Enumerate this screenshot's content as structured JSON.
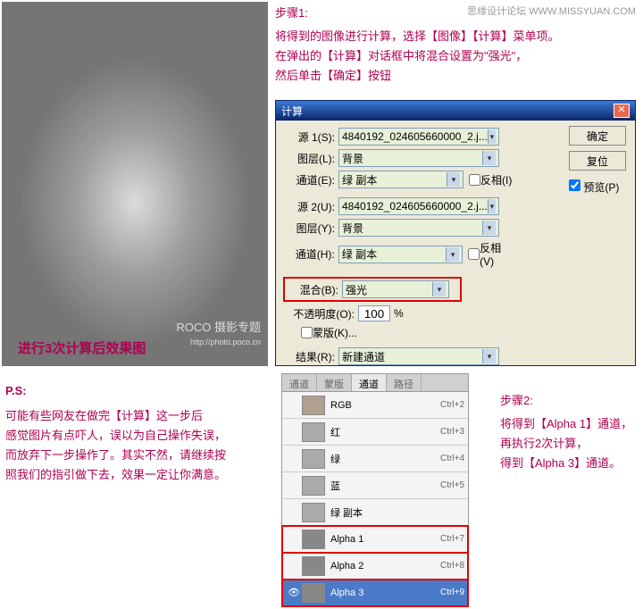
{
  "watermark": "思缘设计论坛  WWW.MISSYUAN.COM",
  "photo": {
    "caption": "进行3次计算后效果图",
    "wm": "ROCO 摄影专题",
    "wm2": "http://photo.poco.cn"
  },
  "step1": {
    "title": "步骤1:",
    "line1": "将得到的图像进行计算，选择【图像】【计算】菜单项。",
    "line2": "在弹出的【计算】对话框中将混合设置为\"强光\"，",
    "line3": "然后单击【确定】按钮"
  },
  "dialog": {
    "title": "计算",
    "source1": {
      "label": "源 1(S):",
      "value": "4840192_024605660000_2.j..."
    },
    "layer1": {
      "label": "图层(L):",
      "value": "背景"
    },
    "channel1": {
      "label": "通道(E):",
      "value": "绿 副本",
      "invert": "反相(I)"
    },
    "source2": {
      "label": "源 2(U):",
      "value": "4840192_024605660000_2.j..."
    },
    "layer2": {
      "label": "图层(Y):",
      "value": "背景"
    },
    "channel2": {
      "label": "通道(H):",
      "value": "绿 副本",
      "invert": "反相(V)"
    },
    "blend": {
      "label": "混合(B):",
      "value": "强光"
    },
    "opacity": {
      "label": "不透明度(O):",
      "value": "100",
      "pct": "%"
    },
    "mask": {
      "label": "蒙版(K)..."
    },
    "result": {
      "label": "结果(R):",
      "value": "新建通道"
    },
    "ok": "确定",
    "cancel": "复位",
    "preview": "预览(P)"
  },
  "channels": {
    "tabs": [
      "通道",
      "蒙版",
      "通道",
      "路径"
    ],
    "rows": [
      {
        "name": "RGB",
        "key": "Ctrl+2",
        "thumb": "#b0a090"
      },
      {
        "name": "红",
        "key": "Ctrl+3",
        "thumb": "#aaa"
      },
      {
        "name": "绿",
        "key": "Ctrl+4",
        "thumb": "#aaa"
      },
      {
        "name": "蓝",
        "key": "Ctrl+5",
        "thumb": "#aaa"
      },
      {
        "name": "绿 副本",
        "key": "",
        "thumb": "#aaa"
      },
      {
        "name": "Alpha 1",
        "key": "Ctrl+7",
        "thumb": "#888"
      },
      {
        "name": "Alpha 2",
        "key": "Ctrl+8",
        "thumb": "#888"
      },
      {
        "name": "Alpha 3",
        "key": "Ctrl+9",
        "thumb": "#888",
        "sel": true,
        "eye": true
      }
    ]
  },
  "ps": {
    "title": "P.S:",
    "text": "可能有些网友在做完【计算】这一步后\n感觉图片有点吓人，误以为自己操作失误，\n而放弃下一步操作了。其实不然，请继续按\n照我们的指引做下去，效果一定让你满意。"
  },
  "step2": {
    "title": "步骤2:",
    "line1": "将得到【Alpha 1】通道，",
    "line2": "再执行2次计算，",
    "line3": "得到【Alpha 3】通道。"
  }
}
